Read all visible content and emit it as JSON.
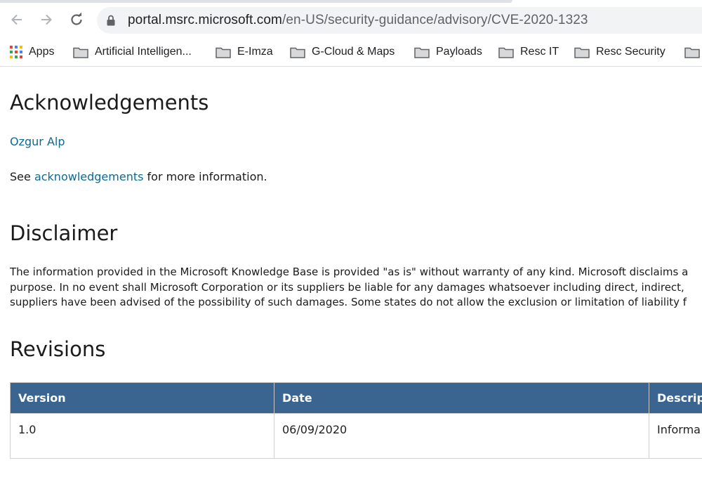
{
  "browser": {
    "url_host": "portal.msrc.microsoft.com",
    "url_path": "/en-US/security-guidance/advisory/CVE-2020-1323",
    "icons": {
      "back": "arrow-left-icon",
      "forward": "arrow-right-icon",
      "reload": "reload-icon",
      "lock": "lock-icon"
    }
  },
  "bookmarks": [
    {
      "label": "Apps",
      "icon": "apps-grid-icon"
    },
    {
      "label": "Artificial Intelligen...",
      "icon": "folder-icon"
    },
    {
      "label": "E-Imza",
      "icon": "folder-icon"
    },
    {
      "label": "G-Cloud & Maps",
      "icon": "folder-icon"
    },
    {
      "label": "Payloads",
      "icon": "folder-icon"
    },
    {
      "label": "Resc IT",
      "icon": "folder-icon"
    },
    {
      "label": "Resc Security",
      "icon": "folder-icon"
    }
  ],
  "acknowledgements": {
    "heading": "Acknowledgements",
    "name": "Ozgur Alp",
    "see_prefix": "See",
    "see_link": "acknowledgements",
    "see_suffix": "for more information."
  },
  "disclaimer": {
    "heading": "Disclaimer",
    "lines": [
      "The information provided in the Microsoft Knowledge Base is provided \"as is\" without warranty of any kind. Microsoft disclaims a",
      "purpose. In no event shall Microsoft Corporation or its suppliers be liable for any damages whatsoever including direct, indirect,",
      "suppliers have been advised of the possibility of such damages. Some states do not allow the exclusion or limitation of liability f"
    ]
  },
  "revisions": {
    "heading": "Revisions",
    "columns": [
      "Version",
      "Date",
      "Descript"
    ],
    "rows": [
      {
        "version": "1.0",
        "date": "06/09/2020",
        "description": "Informa"
      }
    ]
  },
  "colors": {
    "link": "#0e6b8f",
    "table_header_bg": "#3b6591",
    "omnibox_bg": "#f1f3f4"
  }
}
